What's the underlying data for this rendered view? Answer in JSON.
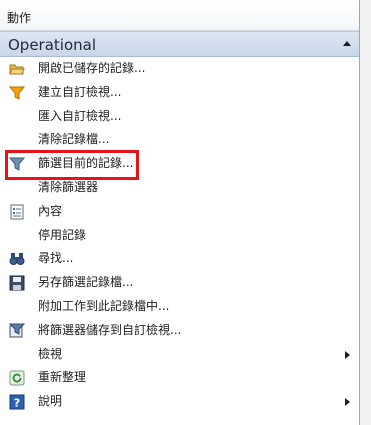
{
  "pane": {
    "title": "動作",
    "section": "Operational"
  },
  "items": [
    {
      "label": "開啟已儲存的記錄...",
      "icon": "open-folder-icon"
    },
    {
      "label": "建立自訂檢視...",
      "icon": "filter-funnel-icon"
    },
    {
      "label": "匯入自訂檢視...",
      "icon": ""
    },
    {
      "label": "清除記錄檔...",
      "icon": ""
    },
    {
      "label": "篩選目前的記錄...",
      "icon": "filter-icon"
    },
    {
      "label": "清除篩選器",
      "icon": ""
    },
    {
      "label": "內容",
      "icon": "properties-icon"
    },
    {
      "label": "停用記錄",
      "icon": ""
    },
    {
      "label": "尋找...",
      "icon": "binoculars-icon"
    },
    {
      "label": "另存篩選記錄檔...",
      "icon": "save-disk-icon"
    },
    {
      "label": "附加工作到此記錄檔中...",
      "icon": ""
    },
    {
      "label": "將篩選器儲存到自訂檢視...",
      "icon": "save-filter-icon"
    },
    {
      "label": "檢視",
      "icon": "",
      "submenu": true
    },
    {
      "label": "重新整理",
      "icon": "refresh-icon"
    },
    {
      "label": "說明",
      "icon": "help-icon",
      "submenu": true
    }
  ],
  "colors": {
    "highlight": "#e5141b",
    "section_bar": "#c8d6ea"
  }
}
